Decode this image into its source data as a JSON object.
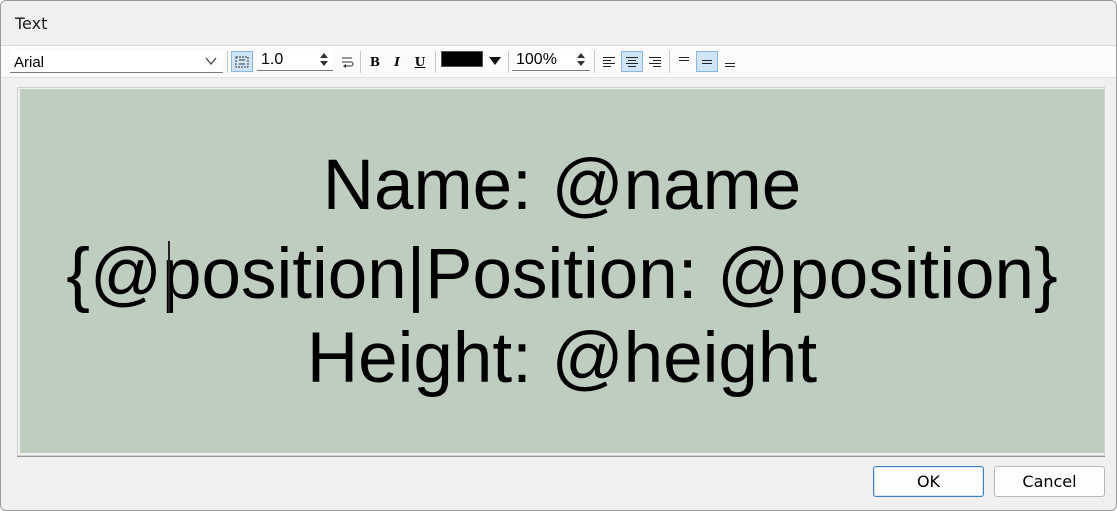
{
  "window": {
    "title": "Text"
  },
  "toolbar": {
    "font_family": "Arial",
    "line_spacing": "1.0",
    "text_color": "#000000",
    "zoom": "100%",
    "horizontal_align": "center",
    "vertical_align": "middle"
  },
  "editor": {
    "background_color": "#bfcdc0",
    "lines": [
      "Name: @name",
      "{@position|Position: @position}",
      "Height: @height"
    ]
  },
  "buttons": {
    "ok": "OK",
    "cancel": "Cancel"
  }
}
